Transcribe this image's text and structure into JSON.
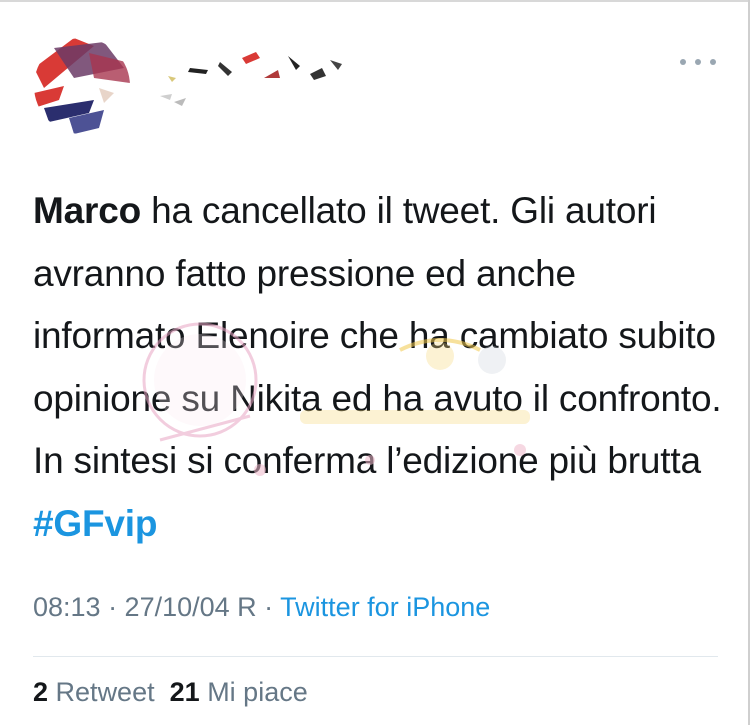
{
  "tweet": {
    "author_mention": "Marco",
    "text_body": " ha cancellato il tweet. Gli autori avranno fatto pressione ed anche informato Elenoire che ha cambiato subito opinione su Nikita ed ha avuto il confronto. In sintesi si conferma l’edizione più brutta ",
    "hashtag": "#GFvip",
    "timestamp": "08:13 · 27/10/04 R · ",
    "source": "Twitter for iPhone",
    "retweets_count": "2",
    "retweets_label": "Retweet",
    "likes_count": "21",
    "likes_label": "Mi piace"
  },
  "icons": {
    "more": "more-dots-icon",
    "avatar": "redacted-avatar",
    "watermark": "watermark-logo"
  },
  "colors": {
    "text": "#14171a",
    "link": "#1b95e0",
    "muted": "#657786",
    "divider": "#e1e8ed"
  }
}
